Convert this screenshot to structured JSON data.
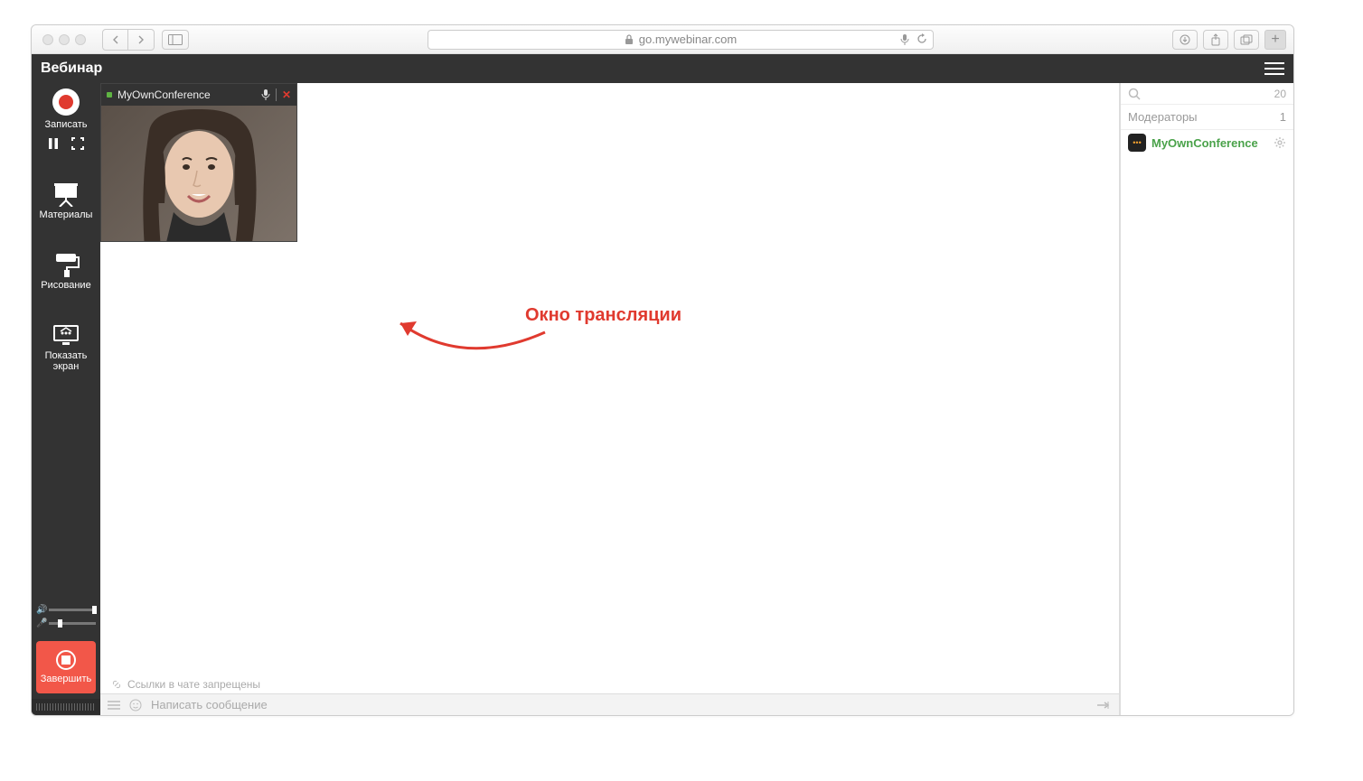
{
  "browser": {
    "url": "go.mywebinar.com"
  },
  "header": {
    "brand": "Вебинар"
  },
  "sidebar": {
    "record": "Записать",
    "materials": "Материалы",
    "drawing": "Рисование",
    "share_screen_l1": "Показать",
    "share_screen_l2": "экран",
    "finish": "Завершить"
  },
  "video": {
    "title": "MyOwnConference"
  },
  "annotation": {
    "label": "Окно трансляции"
  },
  "chat": {
    "hint": "Ссылки в чате запрещены",
    "placeholder": "Написать сообщение"
  },
  "rpanel": {
    "search_count": "20",
    "moderators_label": "Модераторы",
    "moderators_count": "1",
    "user": "MyOwnConference"
  }
}
